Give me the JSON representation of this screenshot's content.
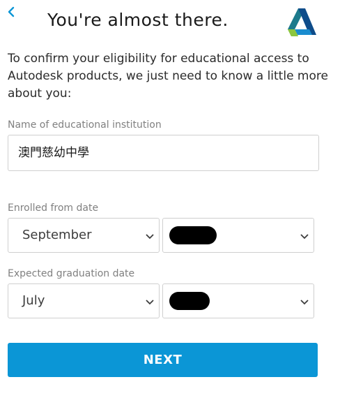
{
  "header": {
    "title": "You're almost there."
  },
  "icons": {
    "back": "chevron-left-icon",
    "logo": "autodesk-logo",
    "dropdown": "chevron-down-icon"
  },
  "intro": {
    "text": "To confirm your eligibility for educational access to Autodesk products, we just need to know a little more about you:"
  },
  "institution": {
    "label": "Name of educational institution",
    "value": "澳門慈幼中學"
  },
  "enrolled": {
    "label": "Enrolled from date",
    "month": "September",
    "year": ""
  },
  "graduation": {
    "label": "Expected graduation date",
    "month": "July",
    "year": ""
  },
  "actions": {
    "next_label": "NEXT"
  },
  "colors": {
    "accent": "#0B96D6",
    "text": "#2B2B2B",
    "label": "#808080",
    "border": "#CFCFCF"
  }
}
